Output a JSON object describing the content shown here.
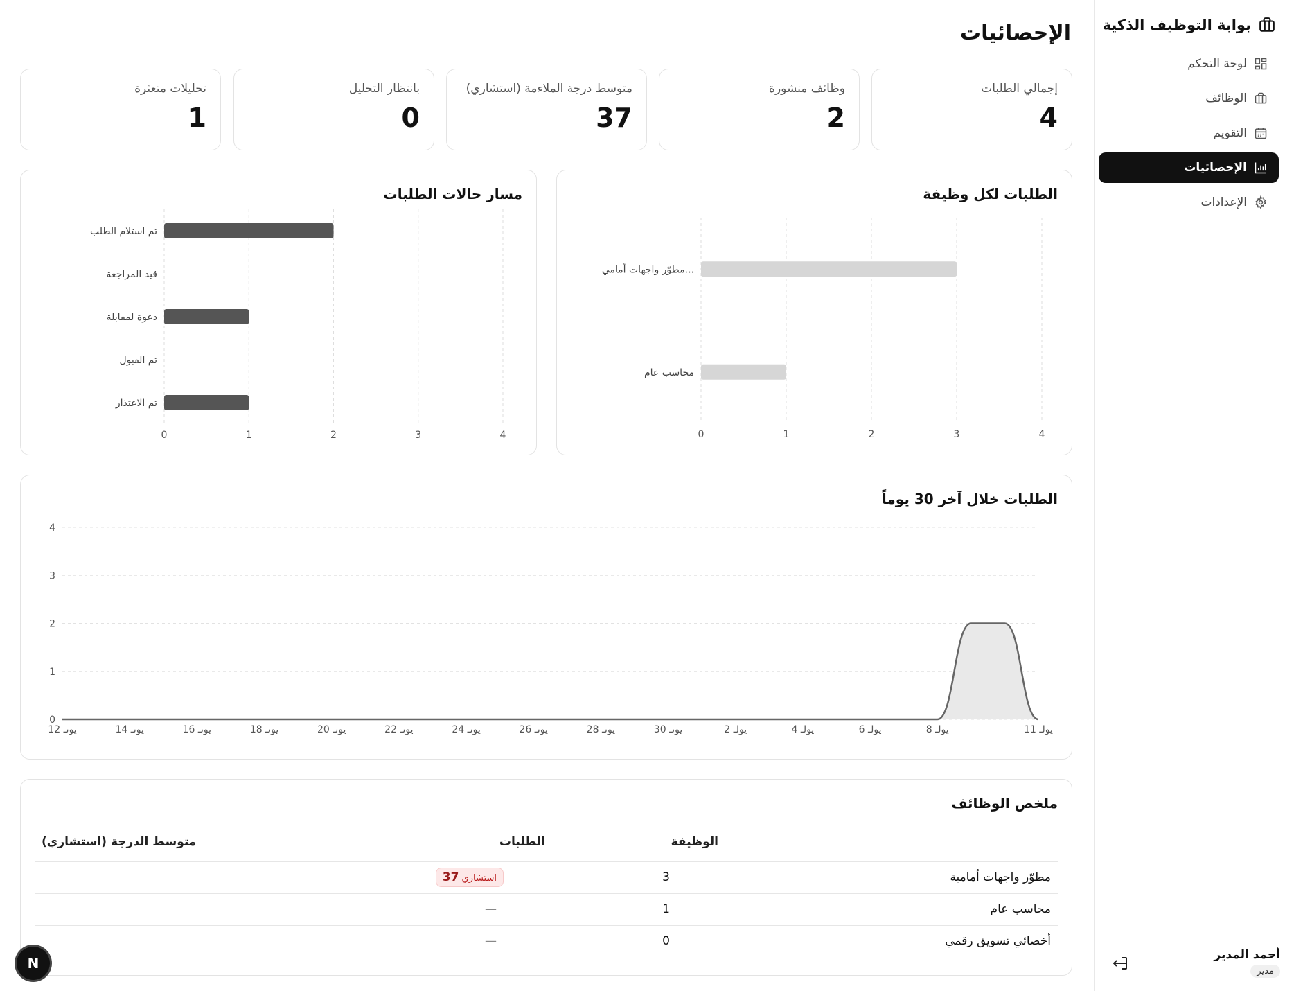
{
  "sidebar": {
    "brand": "بوابة التوظيف الذكية",
    "items": [
      {
        "label": "لوحة التحكم",
        "icon": "dashboard-icon",
        "active": false
      },
      {
        "label": "الوظائف",
        "icon": "briefcase-icon",
        "active": false
      },
      {
        "label": "التقويم",
        "icon": "calendar-icon",
        "active": false
      },
      {
        "label": "الإحصائيات",
        "icon": "bar-chart-icon",
        "active": true
      },
      {
        "label": "الإعدادات",
        "icon": "gear-icon",
        "active": false
      }
    ],
    "user": {
      "name": "أحمد المدير",
      "role": "مدير"
    }
  },
  "page": {
    "title": "الإحصائيات"
  },
  "stats": [
    {
      "label": "إجمالي الطلبات",
      "value": "4"
    },
    {
      "label": "وظائف منشورة",
      "value": "2"
    },
    {
      "label": "متوسط درجة الملاءمة (استشاري)",
      "value": "37"
    },
    {
      "label": "بانتظار التحليل",
      "value": "0"
    },
    {
      "label": "تحليلات متعثرة",
      "value": "1"
    }
  ],
  "chart_data": [
    {
      "type": "bar",
      "orientation": "horizontal",
      "title": "الطلبات لكل وظيفة",
      "categories": [
        "مطوّر واجهات أمامي...",
        "محاسب عام"
      ],
      "values": [
        3,
        1
      ],
      "xlim": [
        0,
        4
      ],
      "xticks": [
        "0",
        "1",
        "2",
        "3",
        "4"
      ],
      "color": "#d6d6d6",
      "grid": true
    },
    {
      "type": "bar",
      "orientation": "horizontal",
      "title": "مسار حالات الطلبات",
      "categories": [
        "تم استلام الطلب",
        "قيد المراجعة",
        "دعوة لمقابلة",
        "تم القبول",
        "تم الاعتذار"
      ],
      "values": [
        2,
        0,
        1,
        0,
        1
      ],
      "xlim": [
        0,
        4
      ],
      "xticks": [
        "0",
        "1",
        "2",
        "3",
        "4"
      ],
      "color": "#555555",
      "grid": true
    },
    {
      "type": "area",
      "title": "الطلبات خلال آخر 30 يوماً",
      "x": [
        "يونيو 12",
        "يونيو 14",
        "يونيو 16",
        "يونيو 18",
        "يونيو 20",
        "يونيو 22",
        "يونيو 24",
        "يونيو 26",
        "يونيو 28",
        "يونيو 30",
        "يوليو 2",
        "يوليو 4",
        "يوليو 6",
        "يوليو 8",
        "يوليو 9",
        "يوليو 10",
        "يوليو 11"
      ],
      "y": [
        0,
        0,
        0,
        0,
        0,
        0,
        0,
        0,
        0,
        0,
        0,
        0,
        0,
        0,
        2,
        2,
        0
      ],
      "xtick_labels": [
        "يونـ 12",
        "يونـ 14",
        "يونـ 16",
        "يونـ 18",
        "يونـ 20",
        "يونـ 22",
        "يونـ 24",
        "يونـ 26",
        "يونـ 28",
        "يونـ 30",
        "يولـ 2",
        "يولـ 4",
        "يولـ 6",
        "يولـ 8",
        "يولـ 11"
      ],
      "ylim": [
        0,
        4
      ],
      "yticks": [
        "0",
        "1",
        "2",
        "3",
        "4"
      ],
      "color": "#666666",
      "fill": "#e9e9e9",
      "grid": true
    }
  ],
  "summary": {
    "title": "ملخص الوظائف",
    "headers": {
      "job": "الوظيفة",
      "count": "الطلبات",
      "score": "متوسط الدرجة (استشاري)"
    },
    "rows": [
      {
        "job": "مطوّر واجهات أمامية",
        "count": "3",
        "score": "37",
        "score_tag": "استشاري"
      },
      {
        "job": "محاسب عام",
        "count": "1",
        "score": "—"
      },
      {
        "job": "أخصائي تسويق رقمي",
        "count": "0",
        "score": "—"
      }
    ]
  },
  "fab": {
    "label": "N"
  }
}
